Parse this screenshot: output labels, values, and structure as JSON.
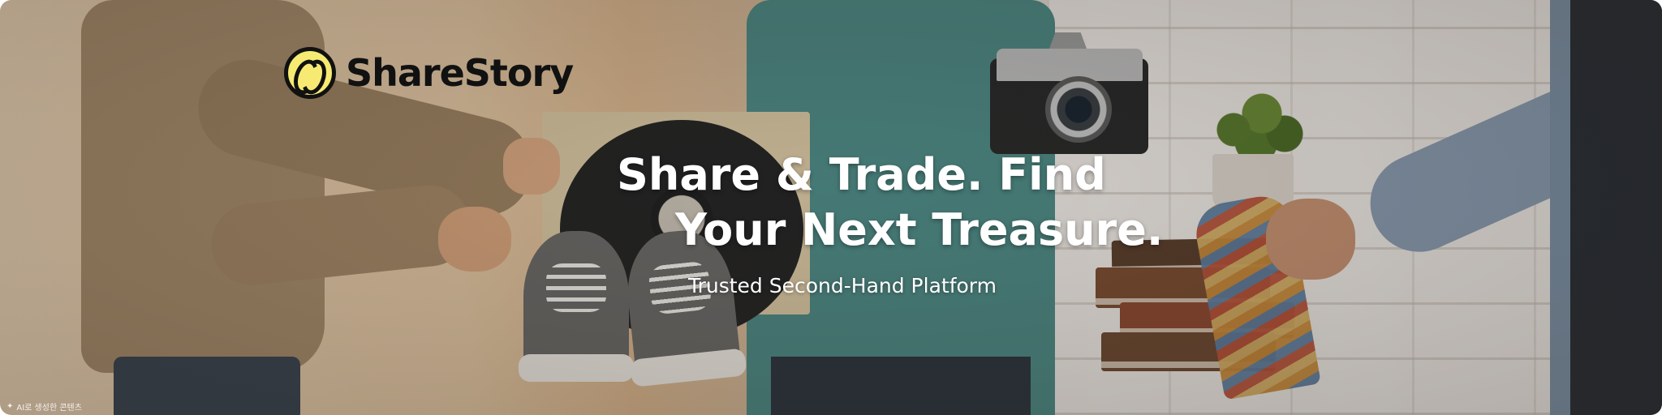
{
  "brand": {
    "name": "ShareStory",
    "logo_icon": "sharestory-logo-icon",
    "accent_color": "#f6ea72"
  },
  "hero": {
    "headline_line1": "Share & Trade. Find",
    "headline_line2": "Your Next Treasure.",
    "subheadline": "Trusted Second-Hand Platform"
  },
  "badge": {
    "icon": "sparkle-icon",
    "text": "AI로 생성한 콘텐츠"
  }
}
